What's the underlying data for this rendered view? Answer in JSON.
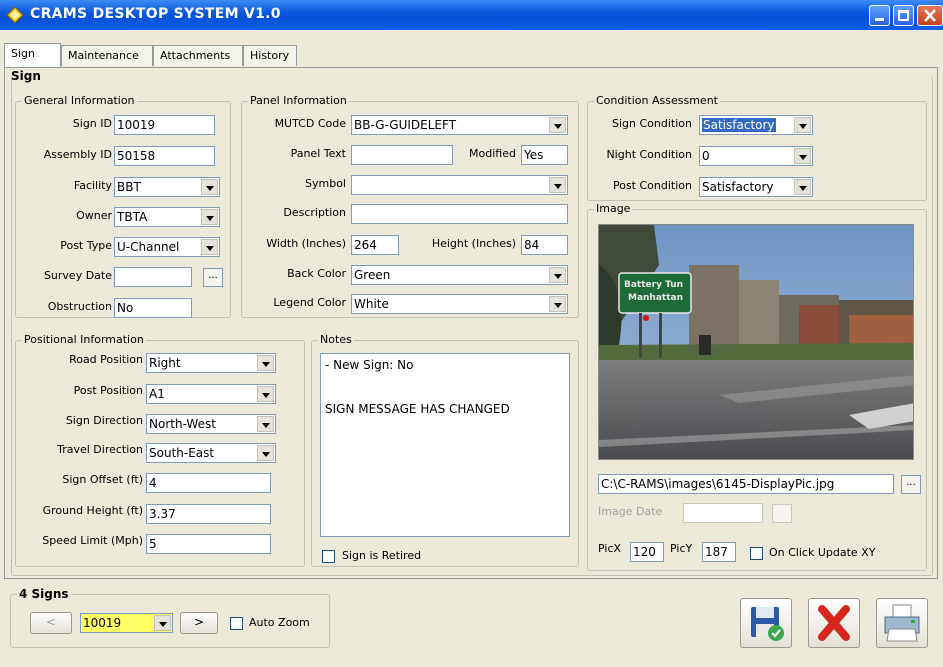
{
  "window": {
    "title": "CRAMS DESKTOP SYSTEM V1.0"
  },
  "tabs": [
    "Sign",
    "Maintenance",
    "Attachments",
    "History"
  ],
  "sign_group": {
    "title": "Sign"
  },
  "general": {
    "title": "General Information",
    "sign_id_label": "Sign ID",
    "sign_id": "10019",
    "assembly_id_label": "Assembly ID",
    "assembly_id": "50158",
    "facility_label": "Facility",
    "facility": "BBT",
    "owner_label": "Owner",
    "owner": "TBTA",
    "post_type_label": "Post Type",
    "post_type": "U-Channel",
    "survey_date_label": "Survey Date",
    "survey_date": "",
    "obstruction_label": "Obstruction",
    "obstruction": "No",
    "ellipsis": "..."
  },
  "panel": {
    "title": "Panel Information",
    "mutcd_label": "MUTCD Code",
    "mutcd": "BB-G-GUIDELEFT",
    "panel_text_label": "Panel Text",
    "panel_text": "",
    "modified_label": "Modified",
    "modified": "Yes",
    "symbol_label": "Symbol",
    "symbol": "",
    "description_label": "Description",
    "description": "",
    "width_label": "Width (Inches)",
    "width": "264",
    "height_label": "Height (Inches)",
    "height": "84",
    "back_color_label": "Back Color",
    "back_color": "Green",
    "legend_color_label": "Legend Color",
    "legend_color": "White"
  },
  "condition": {
    "title": "Condition Assessment",
    "sign_condition_label": "Sign Condition",
    "sign_condition": "Satisfactory",
    "night_condition_label": "Night Condition",
    "night_condition": "0",
    "post_condition_label": "Post Condition",
    "post_condition": "Satisfactory"
  },
  "image": {
    "title": "Image",
    "sign_line1": "Battery Tun",
    "sign_line2": "Manhattan",
    "path": "C:\\C-RAMS\\images\\6145-DisplayPic.jpg",
    "date_label": "Image Date",
    "date": "",
    "picx_label": "PicX",
    "picx": "120",
    "picy_label": "PicY",
    "picy": "187",
    "update_label": "On Click Update XY",
    "ellipsis": "..."
  },
  "positional": {
    "title": "Positional Information",
    "road_position_label": "Road Position",
    "road_position": "Right",
    "post_position_label": "Post Position",
    "post_position": "A1",
    "sign_direction_label": "Sign Direction",
    "sign_direction": "North-West",
    "travel_direction_label": "Travel Direction",
    "travel_direction": "South-East",
    "sign_offset_label": "Sign Offset (ft)",
    "sign_offset": "4",
    "ground_height_label": "Ground Height (ft)",
    "ground_height": "3.37",
    "speed_limit_label": "Speed Limit (Mph)",
    "speed_limit": "5"
  },
  "notes": {
    "title": "Notes",
    "line1": "- New Sign: No",
    "line2": "SIGN MESSAGE HAS CHANGED",
    "retired_label": "Sign is Retired"
  },
  "footer": {
    "title": "4 Signs",
    "prev": "<",
    "next": ">",
    "current": "10019",
    "auto_zoom_label": "Auto Zoom"
  },
  "colors": {
    "selection": "#316ac5",
    "highlight_field": "#ffff66",
    "titlebar": "#0a5be0"
  }
}
